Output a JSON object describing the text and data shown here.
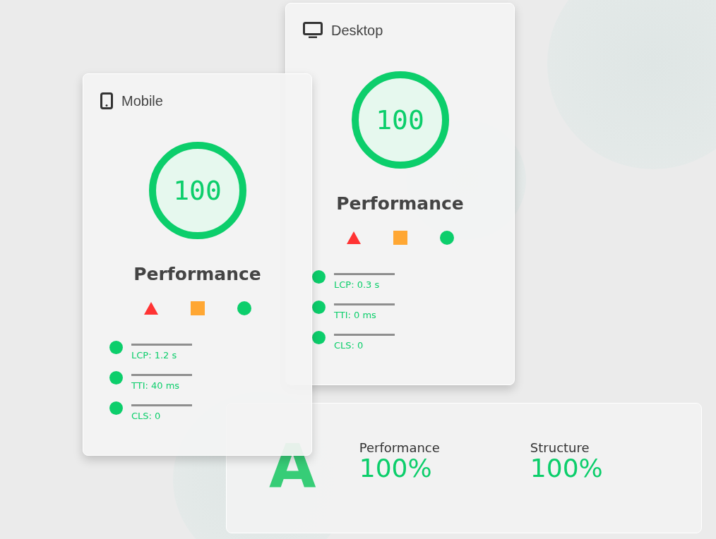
{
  "cards": [
    {
      "kind": "desktop",
      "device": "Desktop",
      "score": "100",
      "level": 1,
      "category": "Performance",
      "metrics": [
        {
          "label": "LCP: 0.3 s",
          "color": "#0cce6b"
        },
        {
          "label": "TTI: 0 ms",
          "color": "#0cce6b"
        },
        {
          "label": "CLS: 0",
          "color": "#0cce6b"
        }
      ]
    },
    {
      "kind": "mobile",
      "device": "Mobile",
      "score": "100",
      "level": 1,
      "category": "Performance",
      "metrics": [
        {
          "label": "LCP: 1.2 s",
          "color": "#0cce6b"
        },
        {
          "label": "TTI: 40 ms",
          "color": "#0cce6b"
        },
        {
          "label": "CLS: 0",
          "color": "#0cce6b"
        }
      ]
    }
  ],
  "summary": {
    "grade": "A",
    "items": [
      {
        "label": "Performance",
        "value": "100%"
      },
      {
        "label": "Structure",
        "value": "100%"
      }
    ]
  }
}
